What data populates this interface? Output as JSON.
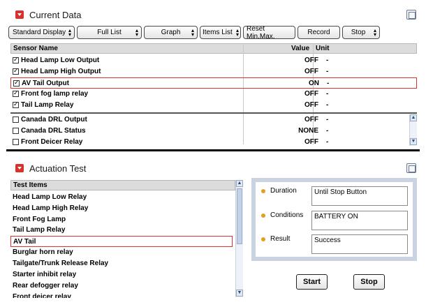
{
  "current_data": {
    "title": "Current Data",
    "toolbar": [
      {
        "label": "Standard Display",
        "dropdown": true
      },
      {
        "label": "Full List",
        "dropdown": true
      },
      {
        "label": "Graph",
        "dropdown": true
      },
      {
        "label": "Items List",
        "dropdown": true
      },
      {
        "label": "Reset Min.Max.",
        "dropdown": false
      },
      {
        "label": "Record",
        "dropdown": false
      },
      {
        "label": "Stop",
        "dropdown": true
      }
    ],
    "columns": {
      "sensor": "Sensor Name",
      "value": "Value",
      "unit": "Unit"
    },
    "rows": [
      {
        "name": "Head Lamp Low Output",
        "value": "OFF",
        "unit": "-",
        "checked": true
      },
      {
        "name": "Head Lamp High Output",
        "value": "OFF",
        "unit": "-",
        "checked": true
      },
      {
        "name": "AV Tail Output",
        "value": "ON",
        "unit": "-",
        "checked": true
      },
      {
        "name": "Front fog lamp relay",
        "value": "OFF",
        "unit": "-",
        "checked": true
      },
      {
        "name": "Tail Lamp Relay",
        "value": "OFF",
        "unit": "-",
        "checked": true
      },
      {
        "name": "Canada DRL Output",
        "value": "OFF",
        "unit": "-",
        "checked": false
      },
      {
        "name": "Canada DRL Status",
        "value": "NONE",
        "unit": "-",
        "checked": false
      },
      {
        "name": "Front Deicer Relay",
        "value": "OFF",
        "unit": "-",
        "checked": false
      }
    ]
  },
  "actuation": {
    "title": "Actuation Test",
    "list_header": "Test Items",
    "items": [
      "Head Lamp Low Relay",
      "Head Lamp High Relay",
      "Front Fog Lamp",
      "Tail Lamp Relay",
      "AV Tail",
      "Burglar horn relay",
      "Tailgate/Trunk Release Relay",
      "Starter inhibit relay",
      "Rear defogger relay",
      "Front deicer relay"
    ],
    "selected_index": 4,
    "details": {
      "duration_label": "Duration",
      "duration_value": "Until Stop Button",
      "conditions_label": "Conditions",
      "conditions_value": "BATTERY ON",
      "result_label": "Result",
      "result_value": "Success"
    },
    "start_label": "Start",
    "stop_label": "Stop"
  },
  "colors": {
    "highlight": "#d9332b",
    "title_icon": "#d8322a",
    "panel_bg": "#c9d3e2",
    "bullet": "#e0a020"
  }
}
